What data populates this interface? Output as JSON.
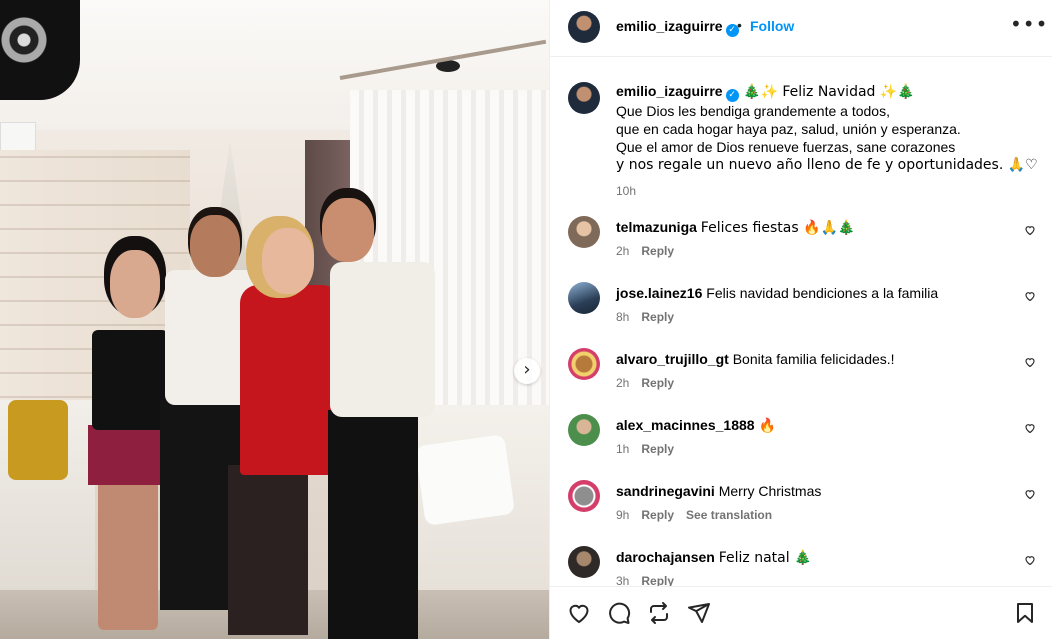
{
  "post": {
    "username": "emilio_izaguirre",
    "follow_label": "Follow",
    "separator": "•",
    "more_label": "•••",
    "carousel_next": "›"
  },
  "caption": {
    "username": "emilio_izaguirre",
    "lines": [
      " 🎄✨ Feliz Navidad ✨🎄",
      "Que Dios les bendiga grandemente a todos,",
      "que en cada hogar haya paz, salud, unión y esperanza.",
      "Que el amor de Dios renueve fuerzas, sane corazones",
      "y nos regale un nuevo año lleno de fe y oportunidades. 🙏♡"
    ],
    "time": "10h"
  },
  "comments": [
    {
      "username": "telmazuniga",
      "text": "Felices fiestas 🔥🙏🎄",
      "time": "2h",
      "reply": "Reply",
      "extra": ""
    },
    {
      "username": "jose.lainez16",
      "text": "Felis navidad bendiciones a la familia",
      "time": "8h",
      "reply": "Reply",
      "extra": ""
    },
    {
      "username": "alvaro_trujillo_gt",
      "text": "Bonita familia felicidades.!",
      "time": "2h",
      "reply": "Reply",
      "extra": ""
    },
    {
      "username": "alex_macinnes_1888",
      "text": "🔥",
      "time": "1h",
      "reply": "Reply",
      "extra": ""
    },
    {
      "username": "sandrinegavini",
      "text": "Merry Christmas",
      "time": "9h",
      "reply": "Reply",
      "extra": "See translation"
    },
    {
      "username": "darochajansen",
      "text": "Feliz natal 🎄",
      "time": "3h",
      "reply": "Reply",
      "extra": ""
    }
  ],
  "icons": {
    "verified": "✓",
    "like": "heart-icon",
    "comment": "comment-icon",
    "share": "repost-icon",
    "send": "send-icon",
    "save": "bookmark-icon"
  },
  "colors": {
    "accent": "#0095f6",
    "muted": "#737373",
    "border": "#efefef"
  }
}
